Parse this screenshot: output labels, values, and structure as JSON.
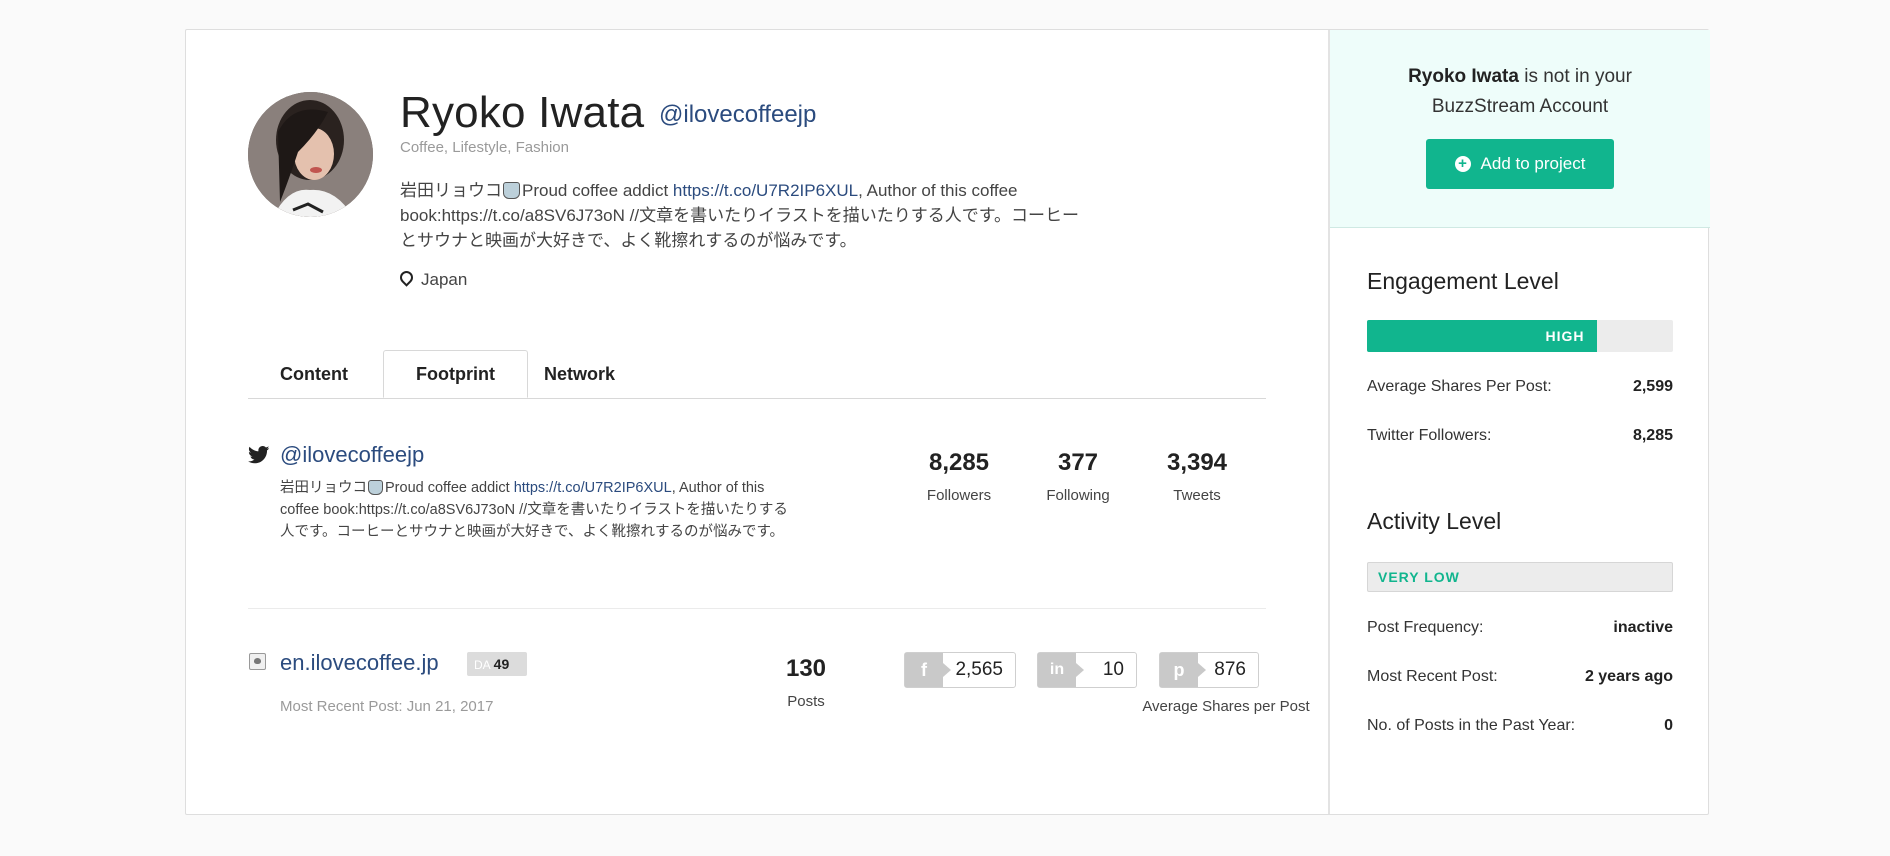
{
  "profile": {
    "name": "Ryoko Iwata",
    "handle": "@ilovecoffeejp",
    "tags": "Coffee, Lifestyle, Fashion",
    "bio_pre": "岩田リョウコ",
    "bio_mid": "Proud coffee addict ",
    "bio_link": "https://t.co/U7R2IP6XUL",
    "bio_post": ", Author of this coffee book:https://t.co/a8SV6J73oN //文章を書いたりイラストを描いたりする人です。コーヒーとサウナと映画が大好きで、よく靴擦れするのが悩みです。",
    "location": "Japan"
  },
  "tabs": [
    {
      "label": "Content"
    },
    {
      "label": "Footprint"
    },
    {
      "label": "Network"
    }
  ],
  "twitter": {
    "handle": "@ilovecoffeejp",
    "bio_pre": "岩田リョウコ",
    "bio_mid": "Proud coffee addict ",
    "bio_link": "https://t.co/U7R2IP6XUL",
    "bio_post": ", Author of this coffee book:https://t.co/a8SV6J73oN //文章を書いたりイラストを描いたりする人です。コーヒーとサウナと映画が大好きで、よく靴擦れするのが悩みです。",
    "stats": [
      {
        "value": "8,285",
        "label": "Followers"
      },
      {
        "value": "377",
        "label": "Following"
      },
      {
        "value": "3,394",
        "label": "Tweets"
      }
    ]
  },
  "website": {
    "name": "en.ilovecoffee.jp",
    "da_label": "DA",
    "da_value": "49",
    "recent_post": "Most Recent Post: Jun 21, 2017",
    "posts_value": "130",
    "posts_label": "Posts",
    "shares": [
      {
        "network": "facebook",
        "glyph": "f",
        "value": "2,565"
      },
      {
        "network": "linkedin",
        "glyph": "in",
        "value": "10"
      },
      {
        "network": "pinterest",
        "glyph": "p",
        "value": "876"
      }
    ],
    "avg_shares_label": "Average Shares per Post"
  },
  "side": {
    "not_in_name": "Ryoko Iwata",
    "not_in_text1": " is not in your",
    "not_in_text2": "BuzzStream Account",
    "add_button": "Add to project",
    "engagement": {
      "title": "Engagement Level",
      "level": "HIGH",
      "level_fraction": 0.75,
      "rows": [
        {
          "label": "Average Shares Per Post:",
          "value": "2,599"
        },
        {
          "label": "Twitter Followers:",
          "value": "8,285"
        }
      ]
    },
    "activity": {
      "title": "Activity Level",
      "level": "VERY LOW",
      "rows": [
        {
          "label": "Post Frequency:",
          "value": "inactive"
        },
        {
          "label": "Most Recent Post:",
          "value": "2 years ago"
        },
        {
          "label": "No. of Posts in the Past Year:",
          "value": "0"
        }
      ]
    }
  },
  "colors": {
    "accent": "#11b58e",
    "link": "#2b4b7e",
    "side_bg": "#eefdfa"
  }
}
